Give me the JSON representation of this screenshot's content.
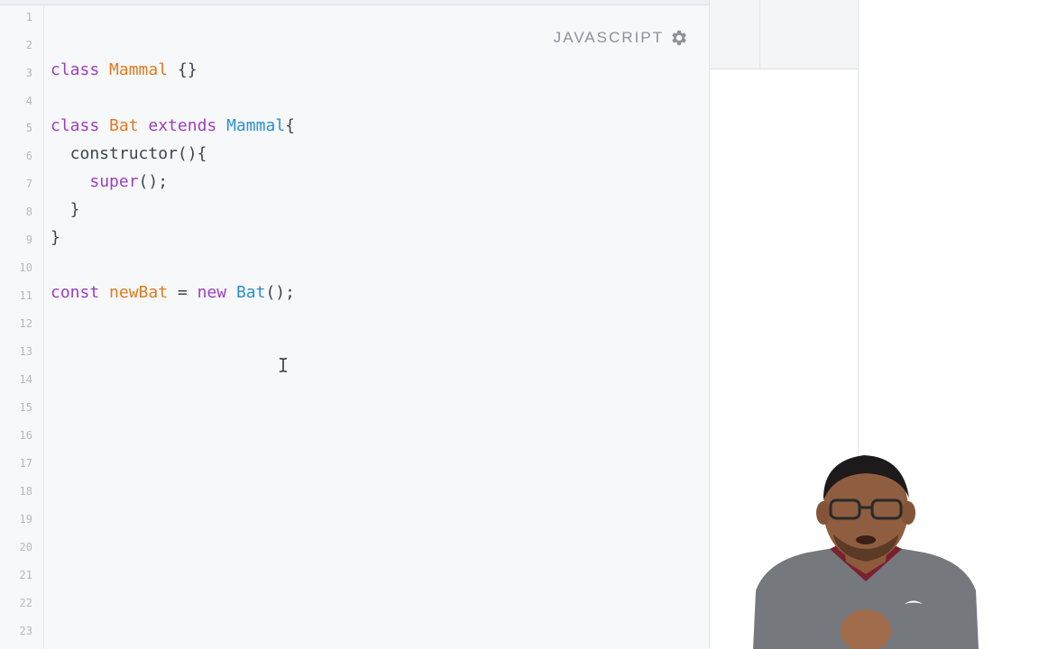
{
  "editor": {
    "language_label": "JAVASCRIPT",
    "settings_icon": "gear-icon",
    "line_numbers": [
      "1",
      "2",
      "3",
      "4",
      "5",
      "6",
      "7",
      "8",
      "9",
      "10",
      "11",
      "12",
      "13",
      "14",
      "15",
      "16",
      "17",
      "18",
      "19",
      "20",
      "21",
      "22",
      "23"
    ],
    "code": {
      "line3": {
        "kw": "class ",
        "name": "Mammal",
        "rest": " {}"
      },
      "line5": {
        "kw": "class ",
        "name": "Bat",
        "ext": " extends ",
        "parent": "Mammal",
        "rest": "{"
      },
      "line6": {
        "text": "  constructor(){"
      },
      "line7": {
        "indent": "    ",
        "kw": "super",
        "rest": "();"
      },
      "line8": {
        "text": "  }"
      },
      "line9": {
        "text": "}"
      },
      "line11": {
        "kw": "const ",
        "var": "newBat",
        "eq": " = ",
        "new": "new ",
        "cls": "Bat",
        "rest": "();"
      }
    }
  },
  "colors": {
    "keyword": "#9b3fbf",
    "class_name": "#e07a1f",
    "parent_class": "#2a8fd6",
    "plain": "#3d4450",
    "line_number": "#b3b8bf"
  },
  "overlay": {
    "cursor_icon": "text-cursor-icon",
    "presenter": "presenter-video"
  }
}
